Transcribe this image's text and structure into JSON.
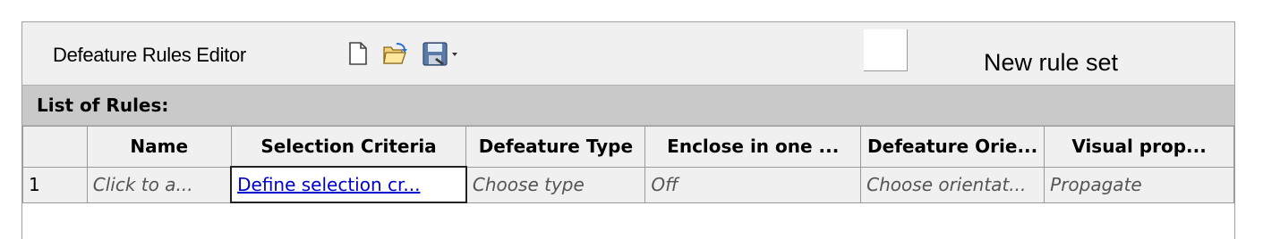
{
  "editor": {
    "title": "Defeature Rules Editor",
    "ruleset_name": "New rule set",
    "toolbar": {
      "new_icon": "new-document-icon",
      "open_icon": "open-folder-icon",
      "save_icon": "save-icon",
      "dropdown_icon": "chevron-down-icon"
    }
  },
  "rules": {
    "label": "List of Rules:",
    "columns": [
      "",
      "Name",
      "Selection Criteria",
      "Defeature Type",
      "Enclose in one ...",
      "Defeature Orie...",
      "Visual prop..."
    ],
    "rows": [
      [
        "1",
        "Click to a...",
        "Define selection cr...",
        "Choose type",
        "Off",
        "Choose orientat...",
        "Propagate"
      ]
    ]
  },
  "colors": {
    "link": "#0000cc",
    "header_bg": "#f0f0f0",
    "list_bar_bg": "#c9c9c9",
    "grid_line": "#9a9a9a"
  }
}
